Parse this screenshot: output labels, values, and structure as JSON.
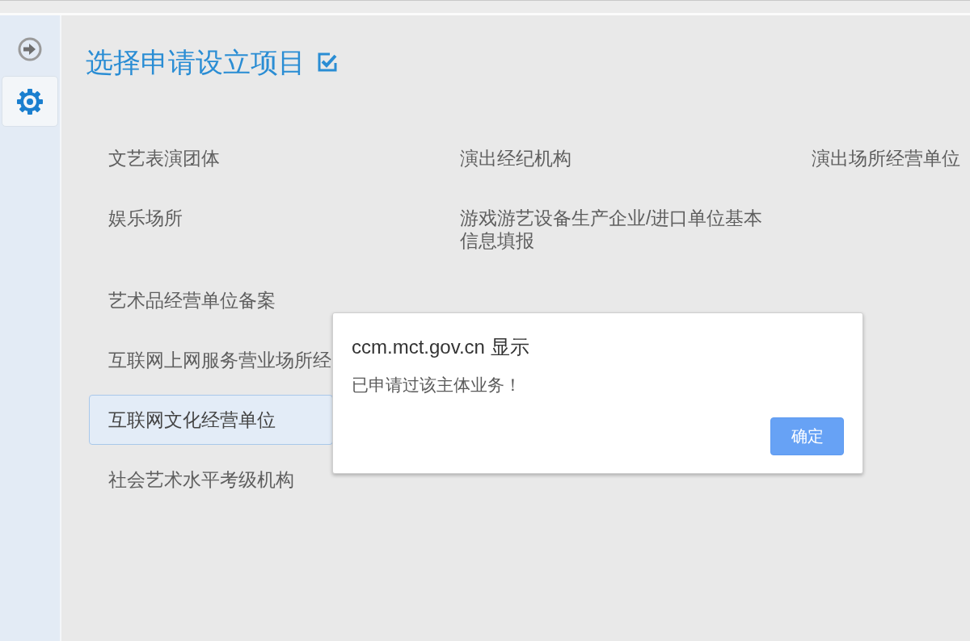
{
  "sidebar": {
    "items": [
      {
        "selected": false
      },
      {
        "selected": true
      }
    ]
  },
  "page": {
    "title": "选择申请设立项目"
  },
  "projects": {
    "rows": [
      [
        {
          "label": "文艺表演团体",
          "selected": false
        },
        {
          "label": "演出经纪机构",
          "selected": false
        },
        {
          "label": "演出场所经营单位",
          "selected": false
        }
      ],
      [
        {
          "label": "娱乐场所",
          "selected": false
        },
        {
          "label": "游戏游艺设备生产企业/进口单位基本信息填报",
          "selected": false
        }
      ],
      [
        {
          "label": "艺术品经营单位备案",
          "selected": false
        }
      ],
      [
        {
          "label": "互联网上网服务营业场所经",
          "selected": false
        }
      ],
      [
        {
          "label": "互联网文化经营单位",
          "selected": true
        }
      ],
      [
        {
          "label": "社会艺术水平考级机构",
          "selected": false
        }
      ]
    ]
  },
  "dialog": {
    "title": "ccm.mct.gov.cn 显示",
    "message": "已申请过该主体业务！",
    "buttons": [
      {
        "label": "确定"
      }
    ]
  }
}
